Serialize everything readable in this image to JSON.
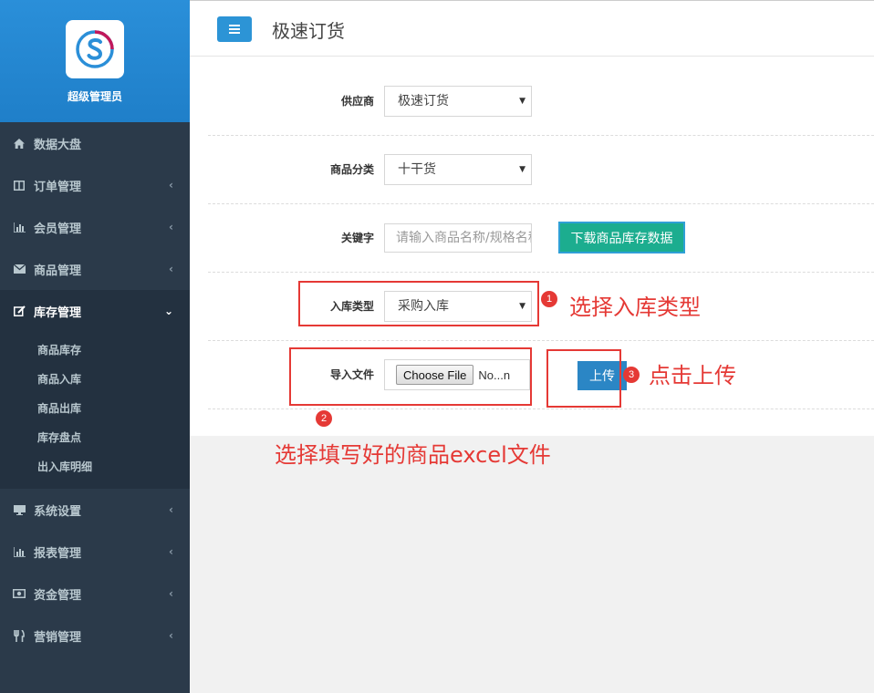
{
  "sidebar": {
    "brand_name": "超级管理员",
    "items": [
      {
        "label": "数据大盘",
        "icon": "home-icon"
      },
      {
        "label": "订单管理",
        "icon": "columns-icon"
      },
      {
        "label": "会员管理",
        "icon": "bar-chart-icon"
      },
      {
        "label": "商品管理",
        "icon": "envelope-icon"
      },
      {
        "label": "库存管理",
        "icon": "edit-icon"
      },
      {
        "label": "系统设置",
        "icon": "desktop-icon"
      },
      {
        "label": "报表管理",
        "icon": "bar-chart-icon"
      },
      {
        "label": "资金管理",
        "icon": "money-icon"
      },
      {
        "label": "营销管理",
        "icon": "cutlery-icon"
      }
    ],
    "inventory_submenu": [
      "商品库存",
      "商品入库",
      "商品出库",
      "库存盘点",
      "出入库明细"
    ]
  },
  "header": {
    "title": "极速订货"
  },
  "form": {
    "supplier": {
      "label": "供应商",
      "value": "极速订货"
    },
    "category": {
      "label": "商品分类",
      "value": "十干货"
    },
    "keyword": {
      "label": "关键字",
      "placeholder": "请输入商品名称/规格名称"
    },
    "download_button": "下载商品库存数据",
    "stock_type": {
      "label": "入库类型",
      "value": "采购入库"
    },
    "import_file": {
      "label": "导入文件",
      "choose_label": "Choose File",
      "file_status": "No...n"
    },
    "upload_button": "上传"
  },
  "annotations": {
    "step1": {
      "num": "1",
      "text": "选择入库类型"
    },
    "step2": {
      "num": "2",
      "text": "选择填写好的商品excel文件"
    },
    "step3": {
      "num": "3",
      "text": "点击上传"
    },
    "color": "#e53935"
  }
}
